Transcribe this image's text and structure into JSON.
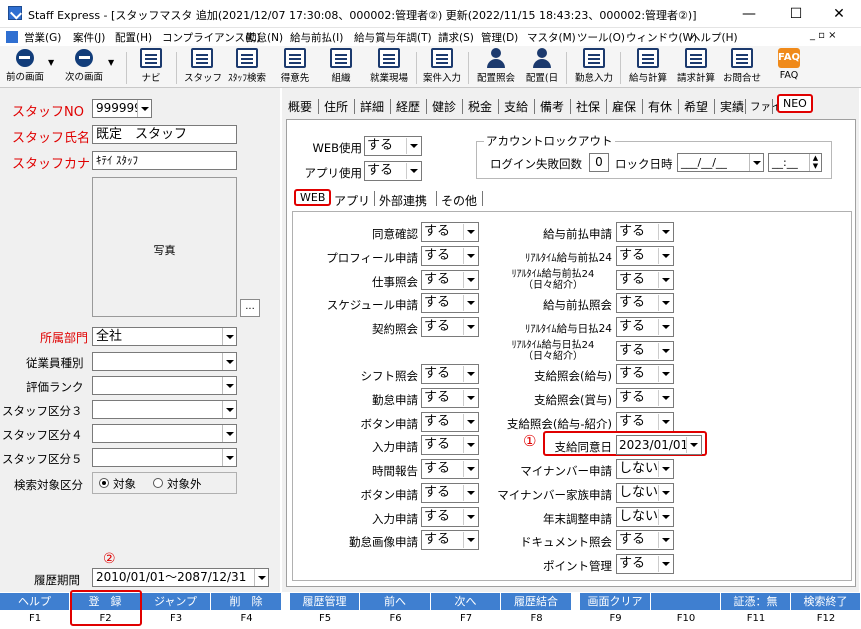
{
  "window": {
    "title": "Staff Express - [スタッフマスタ 追加(2021/12/07 17:30:08、000002:管理者②) 更新(2022/11/15 18:43:23、000002:管理者②)]",
    "minimize": "—",
    "maximize": "☐",
    "close": "✕"
  },
  "menu": {
    "items": [
      "営業(G)",
      "案件(J)",
      "配置(H)",
      "コンプライアンス(C)",
      "勤怠(N)",
      "給与前払(I)",
      "給与賞与年調(T)",
      "請求(S)",
      "管理(D)",
      "マスタ(M)",
      "ツール(O)",
      "ウィンドウ(W)",
      "ヘルプ(H)"
    ],
    "mdi_controls": "_ ▫ ×"
  },
  "toolbar": {
    "items": [
      "前の画面",
      "次の画面",
      "ナビ",
      "スタッフ",
      "ｽﾀｯﾌ検索",
      "得意先",
      "組織",
      "就業現場",
      "案件入力",
      "配置照会",
      "配置(日",
      "勤怠入力",
      "給与計算",
      "請求計算",
      "お問合せ",
      "FAQ"
    ],
    "faq_icon_text": "FAQ"
  },
  "left": {
    "staff_no_label": "スタッフNO",
    "staff_no_value": "999999",
    "staff_name_label": "スタッフ氏名",
    "staff_name_value": "既定　スタッフ",
    "staff_kana_label": "スタッフカナ",
    "staff_kana_value": "ｷﾃｲ ｽﾀｯﾌ",
    "photo_label": "写真",
    "photo_button": "...",
    "dept_label": "所属部門",
    "dept_value": "全社",
    "emp_type_label": "従業員種別",
    "rank_label": "評価ランク",
    "cat3_label": "スタッフ区分３",
    "cat4_label": "スタッフ区分４",
    "cat5_label": "スタッフ区分５",
    "search_label": "検索対象区分",
    "search_opt1": "対象",
    "search_opt2": "対象外",
    "history_label": "履歴期間",
    "history_value": "2010/01/01～2087/12/31",
    "marker2": "②"
  },
  "tabs": [
    "概要",
    "住所",
    "詳細",
    "経歴",
    "健診",
    "税金",
    "支給",
    "備考",
    "社保",
    "雇保",
    "有休",
    "希望",
    "実績",
    "ファイル",
    "NEO"
  ],
  "neo": {
    "web_use_label": "WEB使用",
    "web_use_value": "する",
    "app_use_label": "アプリ使用",
    "app_use_value": "する",
    "lockout_title": "アカウントロックアウト",
    "login_fail_label": "ログイン失敗回数",
    "login_fail_value": "0",
    "lock_time_label": "ロック日時",
    "lock_date_value": "___/__/__",
    "lock_time_value": "__:__",
    "subtabs": [
      "WEB",
      "アプリ",
      "外部連携",
      "その他"
    ],
    "left_rows": [
      {
        "label": "同意確認",
        "value": "する"
      },
      {
        "label": "プロフィール申請",
        "value": "する"
      },
      {
        "label": "仕事照会",
        "value": "する"
      },
      {
        "label": "スケジュール申請",
        "value": "する"
      },
      {
        "label": "契約照会",
        "value": "する"
      },
      {
        "label": "シフト照会",
        "value": "する"
      },
      {
        "label": "勤怠申請",
        "value": "する"
      },
      {
        "label": "ボタン申請",
        "value": "する"
      },
      {
        "label": "入力申請",
        "value": "する"
      },
      {
        "label": "時間報告",
        "value": "する"
      },
      {
        "label": "ボタン申請",
        "value": "する"
      },
      {
        "label": "入力申請",
        "value": "する"
      },
      {
        "label": "勤怠画像申請",
        "value": "する"
      }
    ],
    "right_rows": [
      {
        "label": "給与前払申請",
        "value": "する"
      },
      {
        "label": "ﾘｱﾙﾀｲﾑ給与前払24",
        "value": "する"
      },
      {
        "label": "ﾘｱﾙﾀｲﾑ給与前払24\n（日々紹介）",
        "value": "する"
      },
      {
        "label": "給与前払照会",
        "value": "する"
      },
      {
        "label": "ﾘｱﾙﾀｲﾑ給与日払24",
        "value": "する"
      },
      {
        "label": "ﾘｱﾙﾀｲﾑ給与日払24\n（日々紹介）",
        "value": "する"
      },
      {
        "label": "支給照会(給与)",
        "value": "する"
      },
      {
        "label": "支給照会(賞与)",
        "value": "する"
      },
      {
        "label": "支給照会(給与-紹介)",
        "value": "する"
      },
      {
        "label": "支給同意日",
        "value": "2023/01/01"
      },
      {
        "label": "マイナンバー申請",
        "value": "しない"
      },
      {
        "label": "マイナンバー家族申請",
        "value": "しない"
      },
      {
        "label": "年末調整申請",
        "value": "しない"
      },
      {
        "label": "ドキュメント照会",
        "value": "する"
      },
      {
        "label": "ポイント管理",
        "value": "する"
      }
    ],
    "marker1": "①"
  },
  "fbar": {
    "buttons": [
      "ヘルプ",
      "登　録",
      "ジャンプ",
      "削　除",
      "履歴管理",
      "前へ",
      "次へ",
      "履歴結合",
      "画面クリア",
      "",
      "証憑：無",
      "検索終了"
    ],
    "keys": [
      "F1",
      "F2",
      "F3",
      "F4",
      "F5",
      "F6",
      "F7",
      "F8",
      "F9",
      "F10",
      "F11",
      "F12"
    ]
  },
  "colors": {
    "accent_red": "#e00000",
    "fkey_blue": "#3f7fd0",
    "icon_navy": "#1c3a6e"
  }
}
